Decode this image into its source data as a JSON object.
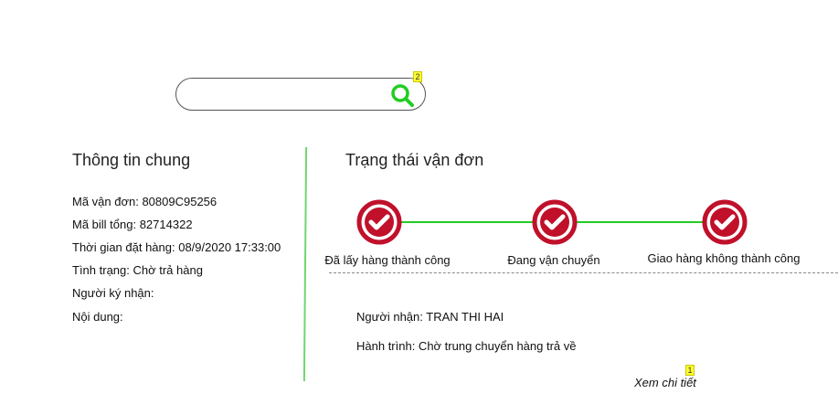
{
  "search": {
    "value": "",
    "placeholder": "",
    "badge": "2"
  },
  "general_info": {
    "title": "Thông tin chung",
    "rows": [
      "Mã vận đơn:  80809C95256",
      "Mã bill tổng: 82714322",
      "Thời gian đặt hàng:  08/9/2020 17:33:00",
      "Tình trạng: Chờ trả hàng",
      "Người ký nhận:",
      "Nội dung:"
    ]
  },
  "status": {
    "title": "Trạng thái vận đơn",
    "steps": [
      {
        "label": "Đã lấy hàng thành công",
        "icon": "check-circle-icon"
      },
      {
        "label": "Đang vận chuyển",
        "icon": "check-circle-icon"
      },
      {
        "label": "Giao hàng không thành công",
        "icon": "check-circle-icon"
      }
    ],
    "recipient": "Người nhận: TRAN THI HAI",
    "journey": "Hành trình: Chờ trung chuyển hàng trả về",
    "view_more": "Xem chi tiết",
    "view_more_badge": "1"
  },
  "colors": {
    "step_icon": "#c0102a",
    "progress_line": "#22cc22",
    "search_icon": "#22cc22",
    "divider": "#6fd66f",
    "badge": "#ffff33"
  }
}
